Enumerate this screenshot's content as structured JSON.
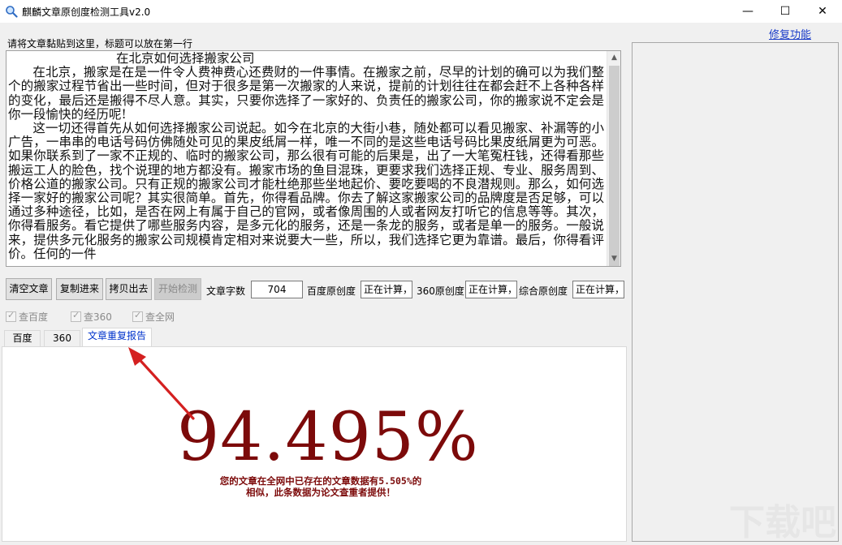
{
  "window": {
    "title": "麒麟文章原创度检测工具v2.0",
    "minimize_glyph": "—",
    "maximize_glyph": "☐",
    "close_glyph": "✕"
  },
  "repair_link": "修复功能",
  "hint": "请将文章黏贴到这里，标题可以放在第一行",
  "article_text": "                           在北京如何选择搬家公司\n      在北京，搬家是在是一件令人费神费心还费财的一件事情。在搬家之前，尽早的计划的确可以为我们整个的搬家过程节省出一些时间，但对于很多是第一次搬家的人来说，提前的计划往往在都会赶不上各种各样的变化，最后还是搬得不尽人意。其实，只要你选择了一家好的、负责任的搬家公司，你的搬家说不定会是你一段愉快的经历呢!\n      这一切还得首先从如何选择搬家公司说起。如今在北京的大街小巷，随处都可以看见搬家、补漏等的小广告，一串串的电话号码仿佛随处可见的果皮纸屑一样，唯一不同的是这些电话号码比果皮纸屑更为可恶。如果你联系到了一家不正规的、临时的搬家公司，那么很有可能的后果是，出了一大笔冤枉钱，还得看那些搬运工人的脸色，找个说理的地方都没有。搬家市场的鱼目混珠，更要求我们选择正规、专业、服务周到、价格公道的搬家公司。只有正规的搬家公司才能杜绝那些坐地起价、要吃要喝的不良潜规则。那么，如何选择一家好的搬家公司呢？其实很简单。首先，你得看品牌。你去了解这家搬家公司的品牌度是否足够，可以通过多种途径，比如，是否在网上有属于自己的官网，或者像周围的人或者网友打听它的信息等等。其次，你得看服务。看它提供了哪些服务内容，是多元化的服务，还是一条龙的服务，或者是单一的服务。一般说来，提供多元化服务的搬家公司规模肯定相对来说要大一些，所以，我们选择它更为靠谱。最后，你得看评价。任何的一件",
  "buttons": {
    "clear": "清空文章",
    "copy_in": "复制进来",
    "copy_out": "拷贝出去",
    "start": "开始检测"
  },
  "stats": {
    "word_count_label": "文章字数",
    "word_count_value": "704",
    "baidu_label": "百度原创度",
    "baidu_value": "正在计算，请",
    "s360_label": "360原创度",
    "s360_value": "正在计算，请",
    "overall_label": "综合原创度",
    "overall_value": "正在计算，请"
  },
  "checks": [
    {
      "label": "查百度",
      "checked": true
    },
    {
      "label": "查360",
      "checked": true
    },
    {
      "label": "查全网",
      "checked": true
    }
  ],
  "tabs": [
    "百度",
    "360",
    "文章重复报告"
  ],
  "active_tab": 2,
  "report": {
    "percentage": "94.495%",
    "summary_line1": "您的文章在全网中已存在的文章数据有5.505%的",
    "summary_line2": "相似，此条数据为论文查重者提供！"
  },
  "colors": {
    "accent_red": "#7c0a0a",
    "arrow_red": "#d42020",
    "link_blue": "#1a3cc8"
  }
}
